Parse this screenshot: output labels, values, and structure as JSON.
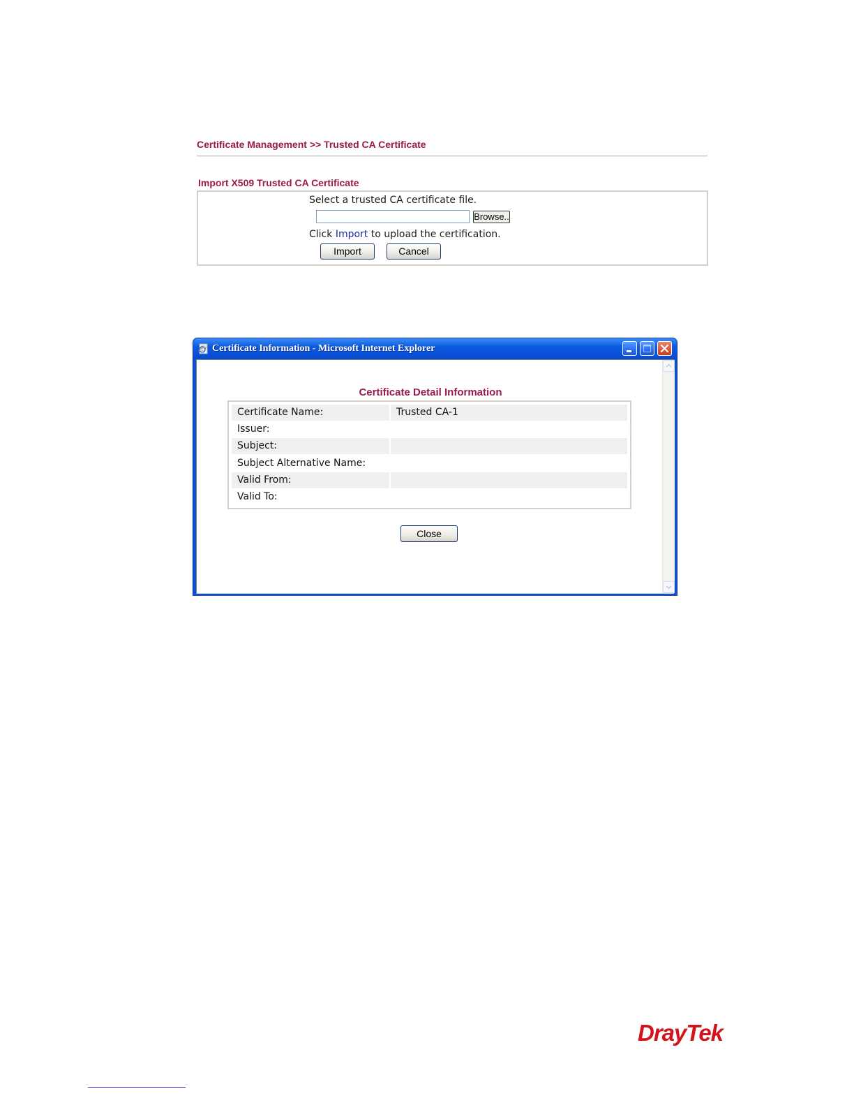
{
  "breadcrumb": "Certificate Management >> Trusted CA Certificate",
  "import_section": {
    "heading": "Import X509 Trusted CA Certificate",
    "select_prompt": "Select a trusted CA certificate file.",
    "file_value": "",
    "browse_label": "Browse..",
    "click_prefix": "Click",
    "click_link": "Import",
    "click_suffix": "to upload the certification.",
    "import_label": "Import",
    "cancel_label": "Cancel"
  },
  "ie_window": {
    "title": "Certificate Information - Microsoft Internet Explorer",
    "detail_title": "Certificate Detail Information",
    "rows": [
      {
        "label": "Certificate Name:",
        "value": "Trusted CA-1"
      },
      {
        "label": "Issuer:",
        "value": ""
      },
      {
        "label": "Subject:",
        "value": ""
      },
      {
        "label": "Subject Alternative Name:",
        "value": ""
      },
      {
        "label": "Valid From:",
        "value": ""
      },
      {
        "label": "Valid To:",
        "value": ""
      }
    ],
    "close_label": "Close"
  },
  "footer": {
    "logo_text": "DrayTek",
    "logo_color": "#d3141c"
  },
  "colors": {
    "heading": "#9a1a4a",
    "link": "#1e2a9e",
    "titlebar": "#0a4fd8"
  }
}
